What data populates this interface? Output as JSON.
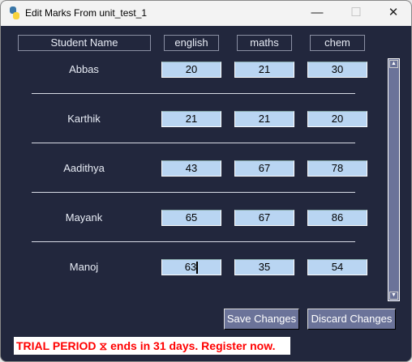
{
  "window": {
    "title": "Edit Marks From unit_test_1",
    "minimize": "—",
    "maximize": "☐",
    "close": "✕"
  },
  "headers": [
    "Student Name",
    "english",
    "maths",
    "chem"
  ],
  "rows": [
    {
      "name": "Abbas",
      "marks": [
        "20",
        "21",
        "30"
      ]
    },
    {
      "name": "Karthik",
      "marks": [
        "21",
        "21",
        "20"
      ]
    },
    {
      "name": "Aadithya",
      "marks": [
        "43",
        "67",
        "78"
      ]
    },
    {
      "name": "Mayank",
      "marks": [
        "65",
        "67",
        "86"
      ]
    },
    {
      "name": "Manoj",
      "marks": [
        "63",
        "35",
        "54"
      ]
    }
  ],
  "buttons": {
    "save": "Save Changes",
    "discard": "Discard Changes"
  },
  "scrollbar": {
    "up": "▲",
    "down": "▼"
  },
  "trial": "TRIAL PERIOD ⧖ ends in 31 days. Register now.",
  "colors": {
    "background": "#22273d",
    "entry": "#b9d5f2",
    "button": "#6b7399",
    "trial_text": "#ff0000"
  }
}
